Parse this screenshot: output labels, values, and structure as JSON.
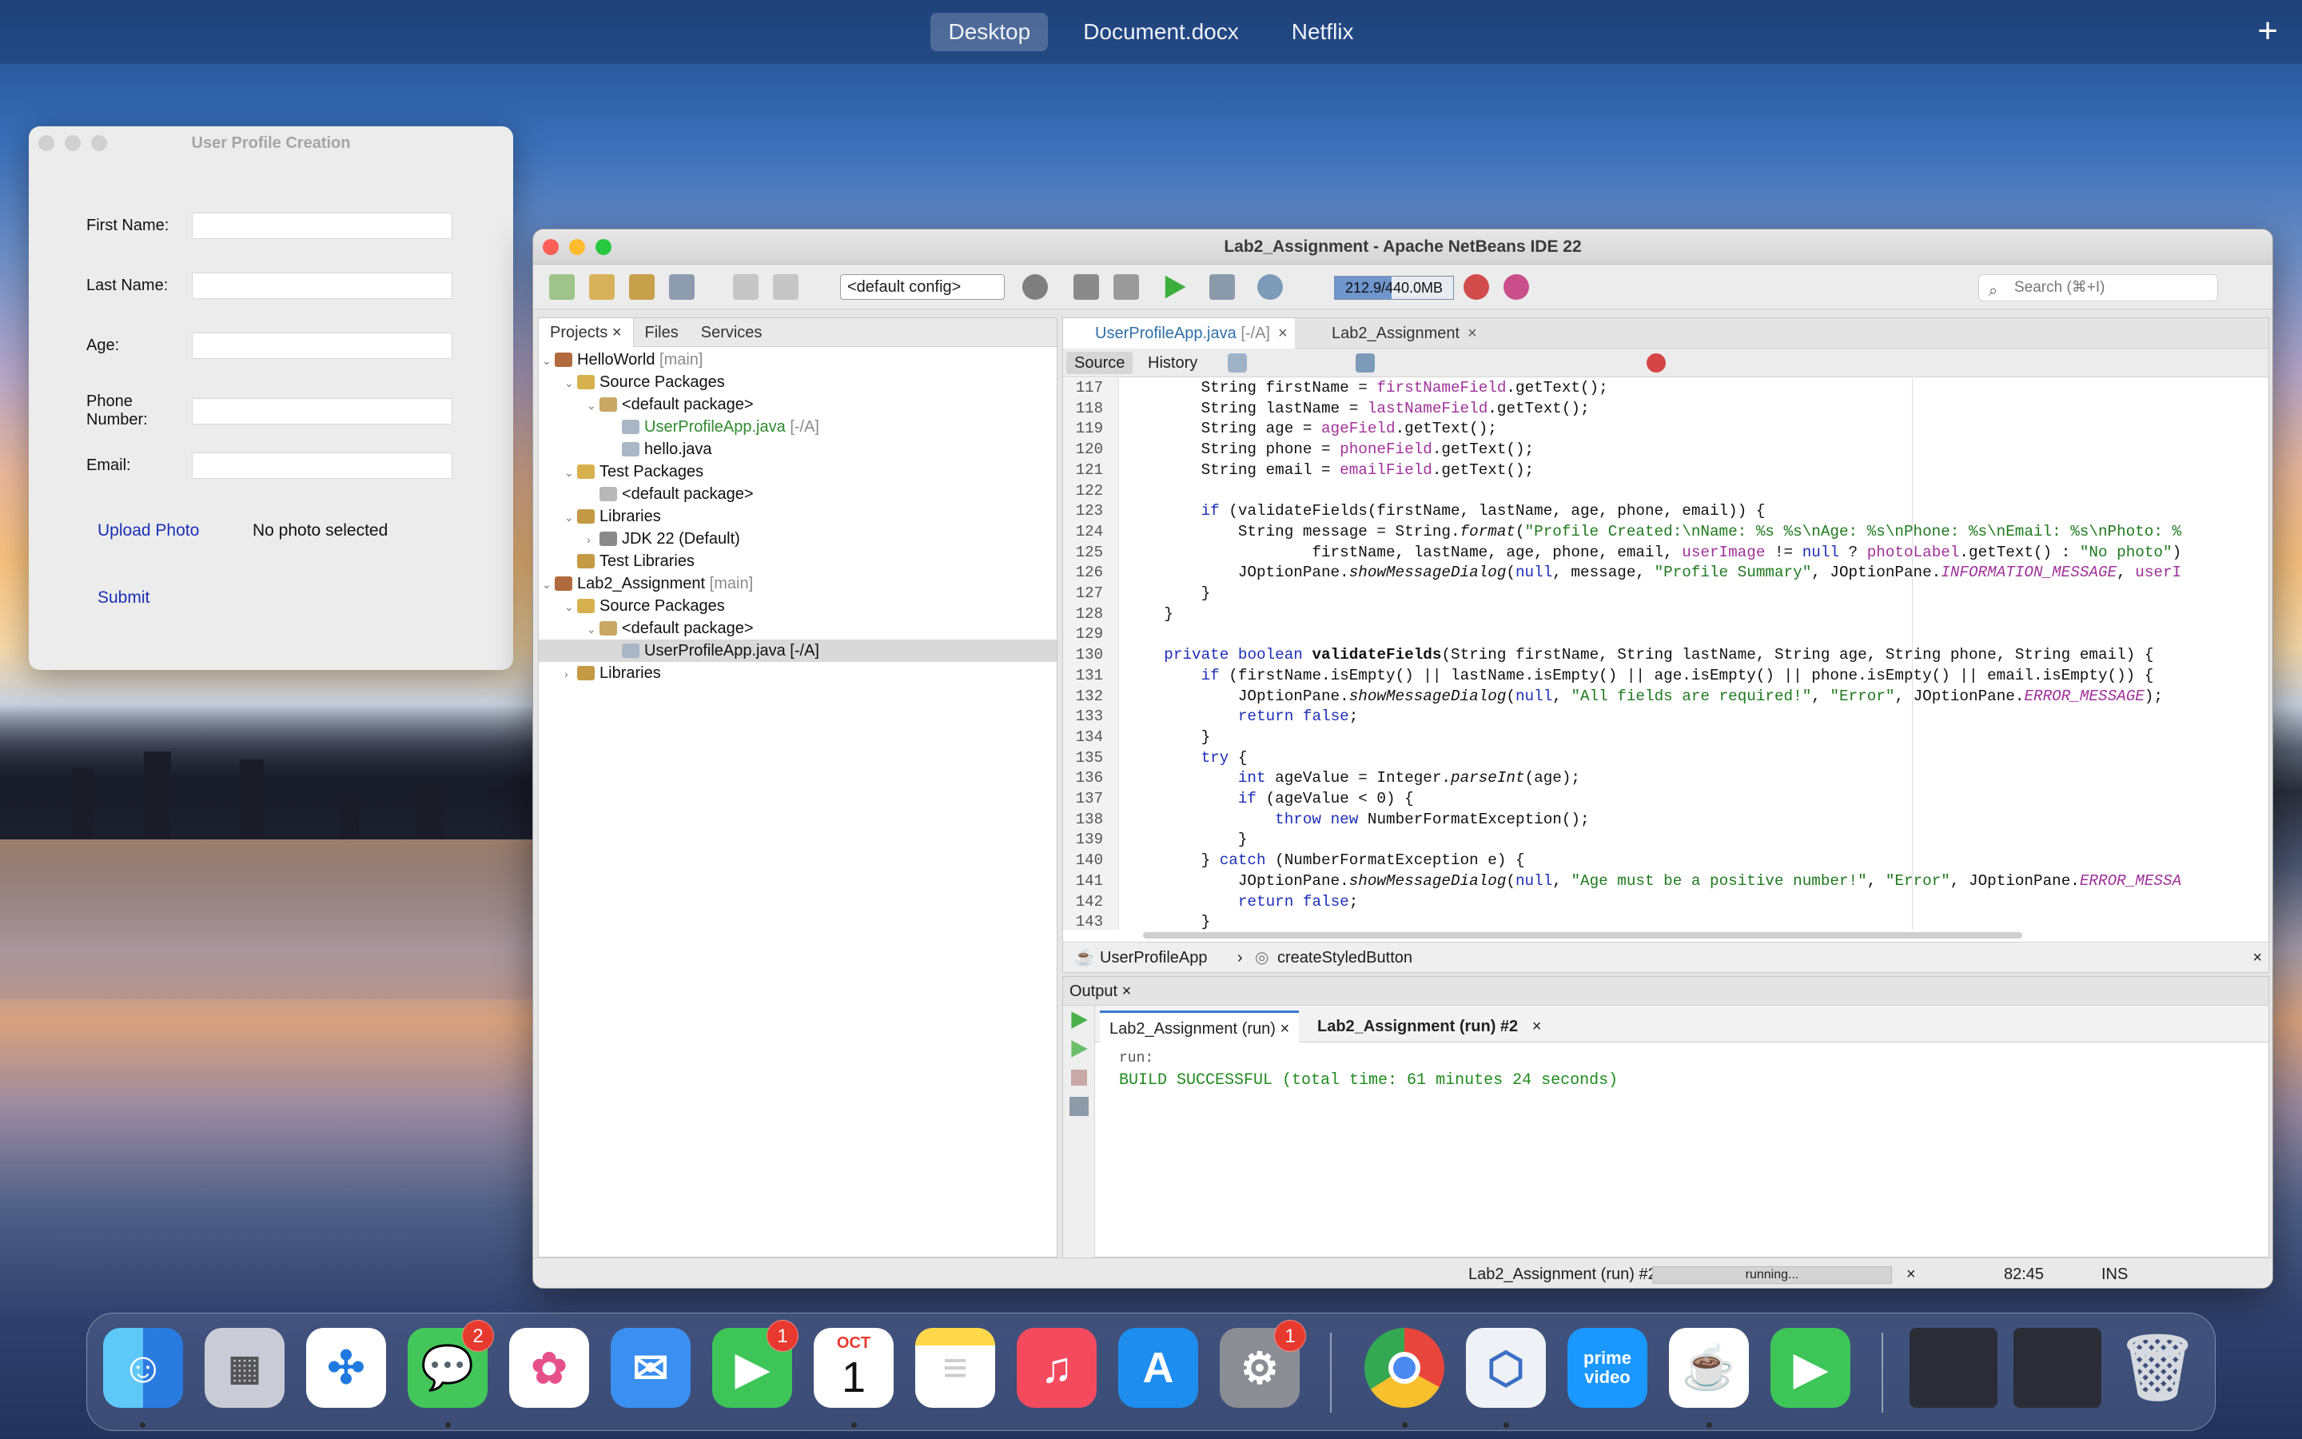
{
  "topbar": {
    "tabs": [
      "Desktop",
      "Document.docx",
      "Netflix"
    ],
    "active": "Desktop",
    "add": "+"
  },
  "profile_window": {
    "title": "User Profile Creation",
    "fields": [
      {
        "label": "First Name:",
        "value": ""
      },
      {
        "label": "Last Name:",
        "value": ""
      },
      {
        "label": "Age:",
        "value": ""
      },
      {
        "label": "Phone Number:",
        "value": ""
      },
      {
        "label": "Email:",
        "value": ""
      }
    ],
    "upload_label": "Upload Photo",
    "photo_status": "No photo selected",
    "submit_label": "Submit"
  },
  "ide": {
    "title": "Lab2_Assignment - Apache NetBeans IDE 22",
    "config": "<default config>",
    "memory": "212.9/440.0MB",
    "memory_fraction": 0.48,
    "search_placeholder": "Search (⌘+I)",
    "panel_tabs": [
      "Projects",
      "Files",
      "Services"
    ],
    "tree": [
      {
        "label": "HelloWorld",
        "suffix": "[main]"
      },
      {
        "label": "Source Packages",
        "suffix": ""
      },
      {
        "label": "<default package>",
        "suffix": ""
      },
      {
        "label": "UserProfileApp.java",
        "suffix": "[-/A]"
      },
      {
        "label": "hello.java",
        "suffix": ""
      },
      {
        "label": "Test Packages",
        "suffix": ""
      },
      {
        "label": "<default package>",
        "suffix": ""
      },
      {
        "label": "Libraries",
        "suffix": ""
      },
      {
        "label": "JDK 22 (Default)",
        "suffix": ""
      },
      {
        "label": "Test Libraries",
        "suffix": ""
      },
      {
        "label": "Lab2_Assignment",
        "suffix": "[main]"
      },
      {
        "label": "Source Packages",
        "suffix": ""
      },
      {
        "label": "<default package>",
        "suffix": ""
      },
      {
        "label": "UserProfileApp.java [-/A]",
        "suffix": ""
      },
      {
        "label": "Libraries",
        "suffix": ""
      }
    ],
    "editor_tabs": [
      "UserProfileApp.java",
      "[-/A]",
      "Lab2_Assignment"
    ],
    "source_label": "Source",
    "history_label": "History",
    "line_numbers": [
      "117",
      "118",
      "119",
      "120",
      "121",
      "122",
      "123",
      "124",
      "125",
      "126",
      "127",
      "128",
      "129",
      "130",
      "131",
      "132",
      "133",
      "134",
      "135",
      "136",
      "137",
      "138",
      "139",
      "140",
      "141",
      "142",
      "143"
    ],
    "breadcrumbs": [
      "UserProfileApp",
      "createStyledButton"
    ],
    "output_title": "Output",
    "output_tabs": [
      "Lab2_Assignment (run)",
      "Lab2_Assignment (run) #2"
    ],
    "output_lines": [
      "run:",
      "BUILD SUCCESSFUL (total time: 61 minutes 24 seconds)"
    ],
    "status": {
      "task": "Lab2_Assignment (run) #2",
      "progress": "running...",
      "position": "82:45",
      "mode": "INS"
    }
  },
  "dock": {
    "apps": [
      {
        "name": "Finder",
        "badge": ""
      },
      {
        "name": "Launchpad",
        "badge": ""
      },
      {
        "name": "Safari",
        "badge": ""
      },
      {
        "name": "Messages",
        "badge": "2"
      },
      {
        "name": "Photos",
        "badge": ""
      },
      {
        "name": "Mail",
        "badge": ""
      },
      {
        "name": "FaceTime",
        "badge": "1"
      },
      {
        "name": "Calendar",
        "badge": "",
        "month": "OCT",
        "day": "1"
      },
      {
        "name": "Notes",
        "badge": ""
      },
      {
        "name": "Music",
        "badge": ""
      },
      {
        "name": "App Store",
        "badge": ""
      },
      {
        "name": "System Settings",
        "badge": "1"
      },
      {
        "name": "Chrome",
        "badge": ""
      },
      {
        "name": "NetBeans",
        "badge": ""
      },
      {
        "name": "Prime Video",
        "badge": "",
        "text": "prime video"
      },
      {
        "name": "Java",
        "badge": ""
      },
      {
        "name": "FaceTime Camera",
        "badge": ""
      }
    ]
  }
}
